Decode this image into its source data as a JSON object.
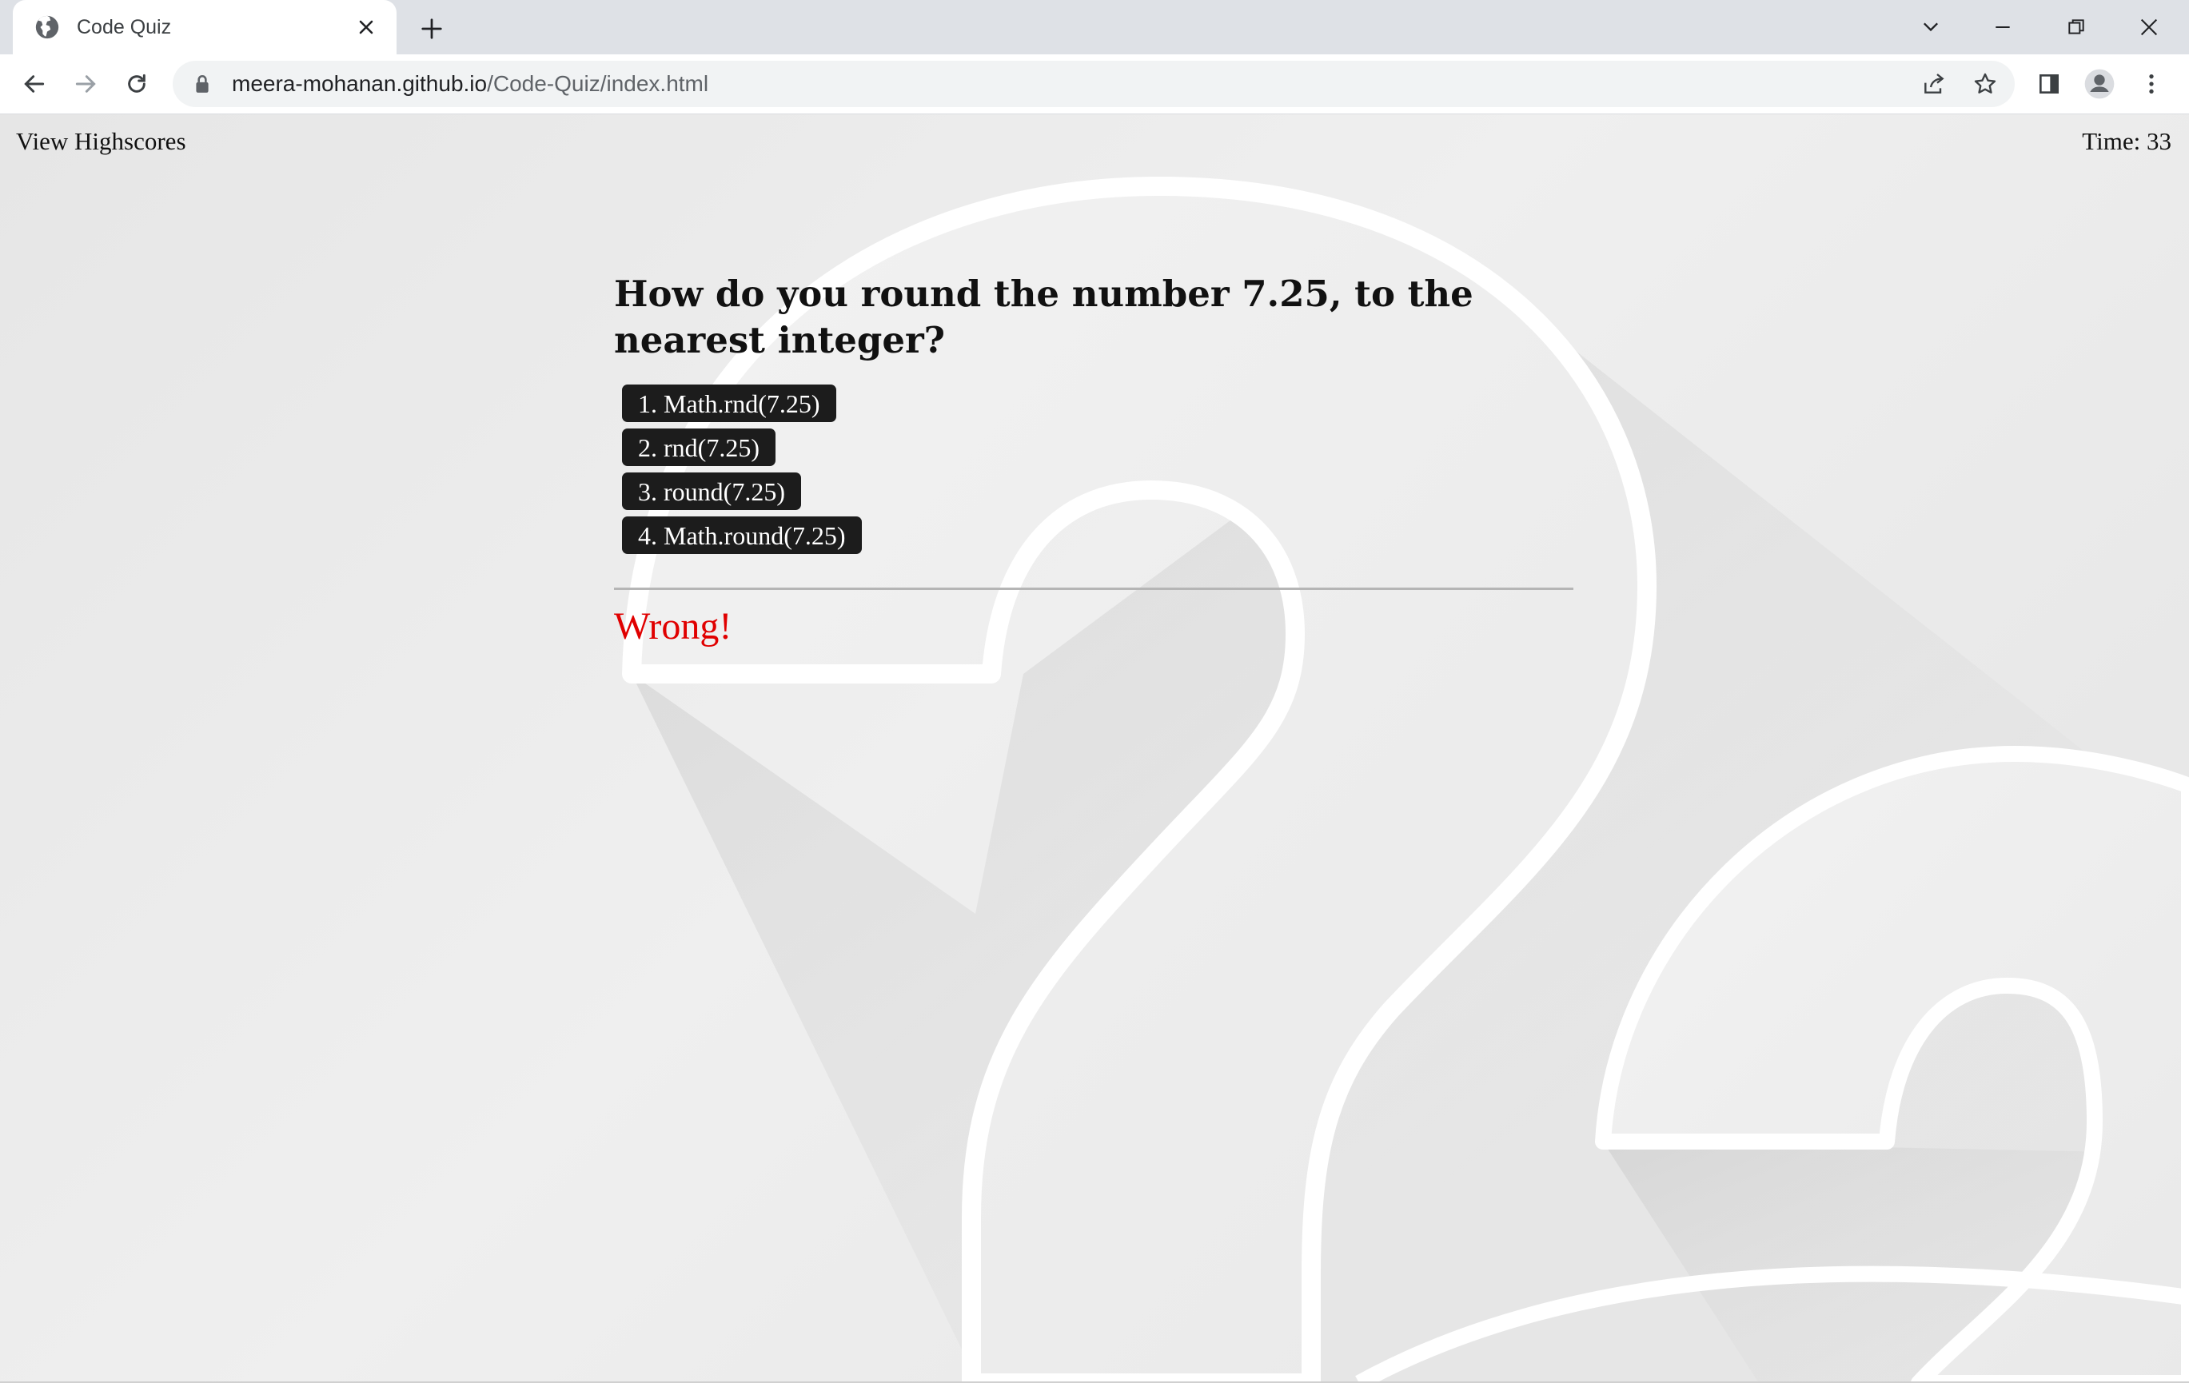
{
  "browser": {
    "tab_title": "Code Quiz",
    "url_host": "meera-mohanan.github.io",
    "url_path": "/Code-Quiz/index.html"
  },
  "page": {
    "view_highscores": "View Highscores",
    "timer": "Time: 33"
  },
  "quiz": {
    "question": "How do you round the number 7.25, to the nearest integer?",
    "choices": [
      "1. Math.rnd(7.25)",
      "2. rnd(7.25)",
      "3. round(7.25)",
      "4. Math.round(7.25)"
    ],
    "feedback": "Wrong!"
  },
  "colors": {
    "feedback": "#e00000",
    "button_bg": "#1c1c1c"
  }
}
